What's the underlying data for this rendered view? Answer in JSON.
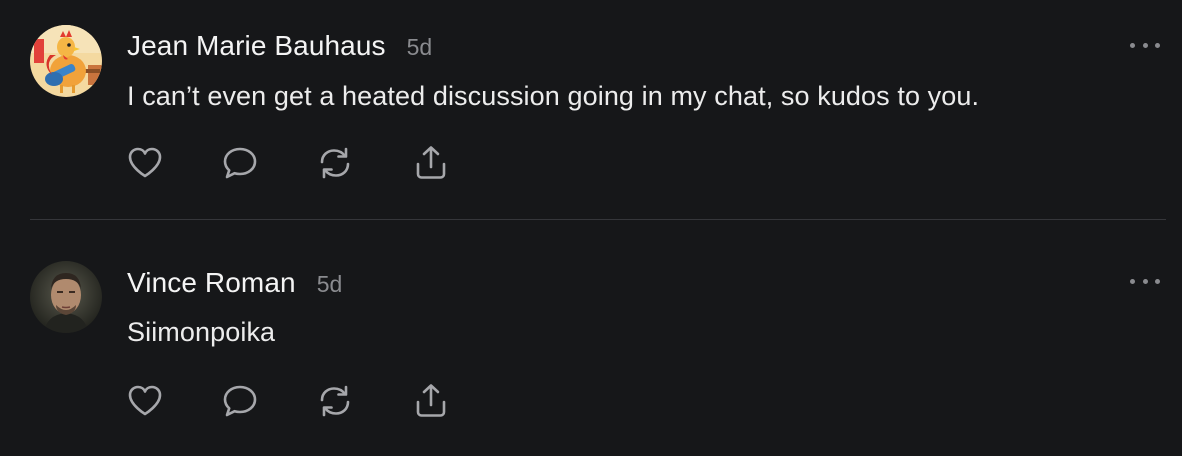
{
  "comments": [
    {
      "author": "Jean Marie Bauhaus",
      "time": "5d",
      "text": "I can’t even get a heated discussion going in my chat, so kudos to you."
    },
    {
      "author": "Vince Roman",
      "time": "5d",
      "text": "Siimonpoika"
    }
  ],
  "icons": {
    "like": "heart-icon",
    "comment": "speech-bubble-icon",
    "restack": "restack-arrows-icon",
    "share": "share-upload-icon",
    "more": "more-horizontal-icon"
  },
  "colors": {
    "background": "#161719",
    "text": "#f2f2f2",
    "muted": "#8a8b8f",
    "divider": "#35363a"
  }
}
